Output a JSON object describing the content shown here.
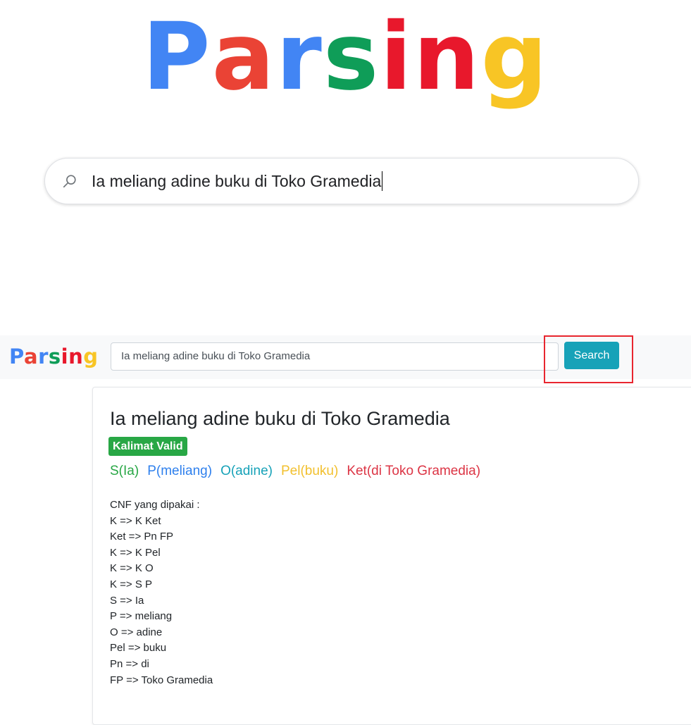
{
  "hero": {
    "logo_letters": [
      {
        "char": "P",
        "color": "#4285f4"
      },
      {
        "char": "a",
        "color": "#ea4335"
      },
      {
        "char": "r",
        "color": "#4285f4"
      },
      {
        "char": "s",
        "color": "#0f9d58"
      },
      {
        "char": "i",
        "color": "#e8182c"
      },
      {
        "char": "n",
        "color": "#e8182c"
      },
      {
        "char": "g",
        "color": "#f8c525"
      }
    ],
    "search_value": "Ia meliang adine buku di Toko Gramedia",
    "search_icon": "search-icon"
  },
  "navbar": {
    "brand_letters": [
      {
        "char": "P",
        "color": "#4285f4"
      },
      {
        "char": "a",
        "color": "#ea4335"
      },
      {
        "char": "r",
        "color": "#4285f4"
      },
      {
        "char": "s",
        "color": "#0f9d58"
      },
      {
        "char": "i",
        "color": "#e8182c"
      },
      {
        "char": "n",
        "color": "#e8182c"
      },
      {
        "char": "g",
        "color": "#f8c525"
      }
    ],
    "search_value": "Ia meliang adine buku di Toko Gramedia",
    "search_button": "Search",
    "button_color": "#17a2b8",
    "highlight_color": "#e8262f"
  },
  "result": {
    "title": "Ia meliang adine buku di Toko Gramedia",
    "badge": "Kalimat Valid",
    "badge_color": "#28a745",
    "roles": [
      {
        "text": "S(Ia)",
        "color": "#28a745"
      },
      {
        "text": "P(meliang)",
        "color": "#2f80ed"
      },
      {
        "text": "O(adine)",
        "color": "#17a2b8"
      },
      {
        "text": "Pel(buku)",
        "color": "#f2c02e"
      },
      {
        "text": "Ket(di Toko Gramedia)",
        "color": "#dc3545"
      }
    ],
    "cnf_heading": "CNF yang dipakai :",
    "cnf_rules": [
      "K => K Ket",
      "Ket => Pn FP",
      "K => K Pel",
      "K => K O",
      "K => S P",
      "S => Ia",
      "P => meliang",
      "O => adine",
      "Pel => buku",
      "Pn => di",
      "FP => Toko Gramedia"
    ]
  }
}
